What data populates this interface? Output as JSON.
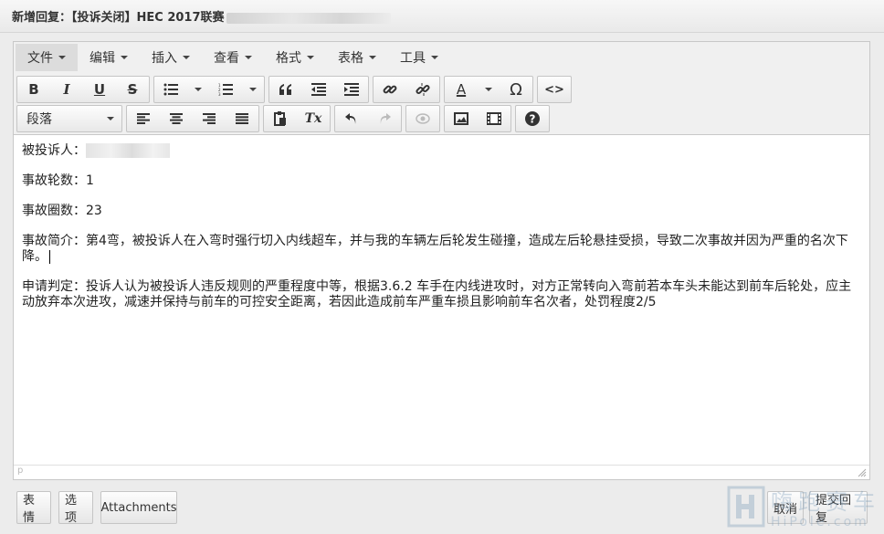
{
  "window": {
    "title": "新增回复：【投诉关闭】HEC 2017联赛"
  },
  "menubar": [
    {
      "label": "文件",
      "active": true
    },
    {
      "label": "编辑"
    },
    {
      "label": "插入"
    },
    {
      "label": "查看"
    },
    {
      "label": "格式"
    },
    {
      "label": "表格"
    },
    {
      "label": "工具"
    }
  ],
  "toolbar": {
    "bold": "B",
    "italic": "I",
    "underline": "U",
    "strike": "S",
    "text_color": "A",
    "special_char": "Ω",
    "source_code": "<>",
    "clear_format": "Tx",
    "block_format": "段落",
    "quote": "66"
  },
  "content": {
    "respondent_label": "被投诉人：",
    "accident_lap_label": "事故轮数：",
    "accident_lap_value": "1",
    "accident_circle_label": "事故圈数：",
    "accident_circle_value": "23",
    "summary_label": "事故简介：",
    "summary_text": "第4弯，被投诉人在入弯时强行切入内线超车，并与我的车辆左后轮发生碰撞，造成左后轮悬挂受损，导致二次事故并因为严重的名次下降。",
    "ruling_label": "申请判定：",
    "ruling_text": "投诉人认为被投诉人违反规则的严重程度中等，根据3.6.2 车手在内线进攻时，对方正常转向入弯前若本车头未能达到前车后轮处，应主动放弃本次进攻，减速并保持与前车的可控安全距离，若因此造成前车严重车损且影响前车名次者，处罚程度2/5"
  },
  "statusbar": {
    "path": "p"
  },
  "footer": {
    "emoji_label": "表情",
    "options_label": "选项",
    "attachments_label": "Attachments",
    "cancel_label": "取消",
    "submit_label": "提交回复"
  },
  "watermark": {
    "text": "HiPole.com",
    "cn_text": "嗨跑赛车"
  },
  "colors": {
    "toolbar_bg": "#f0f0f0",
    "border": "#c8c8c8",
    "page_bg": "#ececec"
  }
}
